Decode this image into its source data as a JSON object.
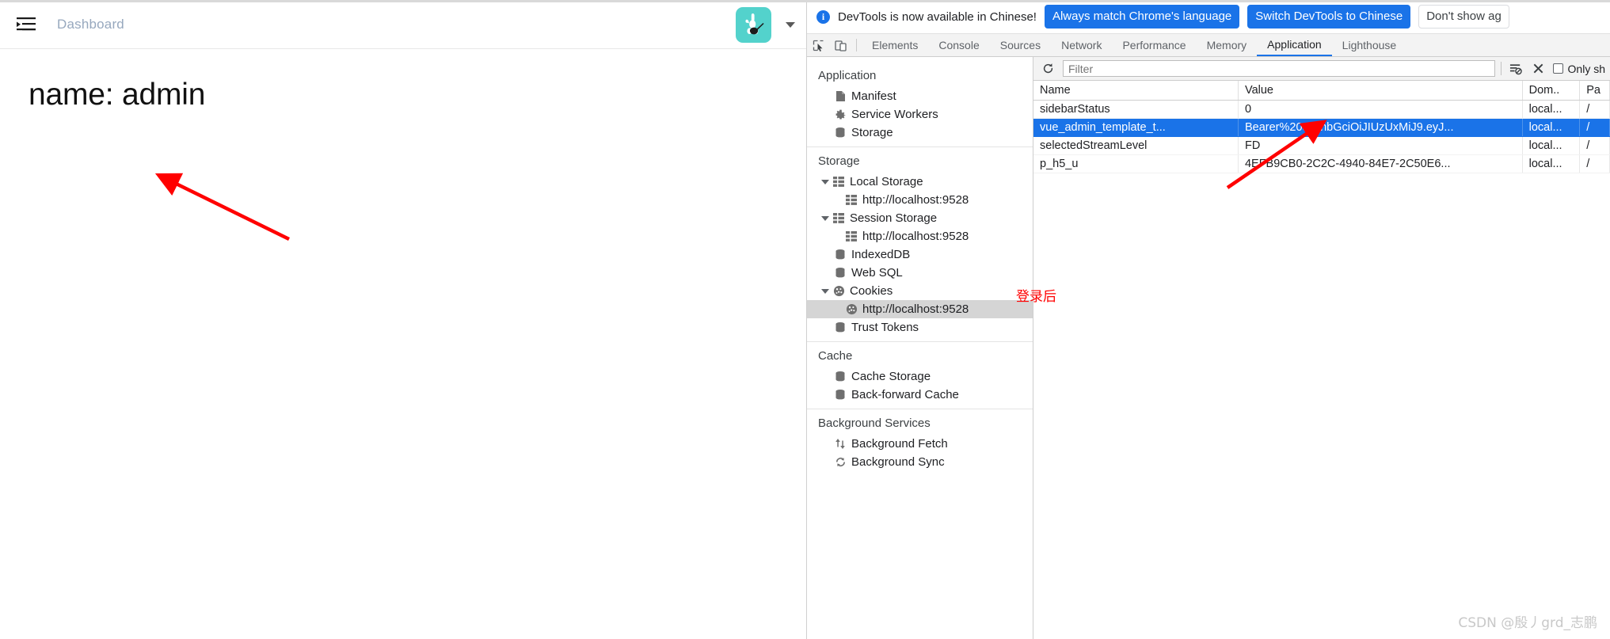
{
  "webpage": {
    "hamburger_icon": "hamburger-menu-icon",
    "breadcrumb": "Dashboard",
    "avatar_icon": "cat-avatar-icon",
    "avatar_color": "#53d2cc",
    "caret_icon": "chevron-down-icon",
    "heading": "name: admin"
  },
  "devtools": {
    "banner": {
      "info_icon": "info-icon",
      "text": "DevTools is now available in Chinese!",
      "buttons": [
        {
          "label": "Always match Chrome's language",
          "style": "primary"
        },
        {
          "label": "Switch DevTools to Chinese",
          "style": "primary"
        },
        {
          "label": "Don't show ag",
          "style": "secondary"
        }
      ],
      "primary_color": "#1a73e8"
    },
    "toolbar_icons": [
      {
        "name": "inspect-element-icon"
      },
      {
        "name": "device-toolbar-icon"
      }
    ],
    "tabs": [
      {
        "label": "Elements",
        "active": false
      },
      {
        "label": "Console",
        "active": false
      },
      {
        "label": "Sources",
        "active": false
      },
      {
        "label": "Network",
        "active": false
      },
      {
        "label": "Performance",
        "active": false
      },
      {
        "label": "Memory",
        "active": false
      },
      {
        "label": "Application",
        "active": true
      },
      {
        "label": "Lighthouse",
        "active": false
      }
    ],
    "sidebar": {
      "sections": [
        {
          "title": "Application",
          "items": [
            {
              "label": "Manifest",
              "icon": "document-icon",
              "indent": 2,
              "twisty": false,
              "selected": false
            },
            {
              "label": "Service Workers",
              "icon": "gear-icon",
              "indent": 2,
              "twisty": false,
              "selected": false
            },
            {
              "label": "Storage",
              "icon": "database-icon",
              "indent": 2,
              "twisty": false,
              "selected": false
            }
          ]
        },
        {
          "title": "Storage",
          "items": [
            {
              "label": "Local Storage",
              "icon": "table-icon",
              "indent": 1,
              "twisty": true,
              "selected": false
            },
            {
              "label": "http://localhost:9528",
              "icon": "table-icon",
              "indent": 3,
              "twisty": false,
              "selected": false
            },
            {
              "label": "Session Storage",
              "icon": "table-icon",
              "indent": 1,
              "twisty": true,
              "selected": false
            },
            {
              "label": "http://localhost:9528",
              "icon": "table-icon",
              "indent": 3,
              "twisty": false,
              "selected": false
            },
            {
              "label": "IndexedDB",
              "icon": "database-icon",
              "indent": 2,
              "twisty": false,
              "selected": false
            },
            {
              "label": "Web SQL",
              "icon": "database-icon",
              "indent": 2,
              "twisty": false,
              "selected": false
            },
            {
              "label": "Cookies",
              "icon": "cookie-icon",
              "indent": 1,
              "twisty": true,
              "selected": false
            },
            {
              "label": "http://localhost:9528",
              "icon": "cookie-icon",
              "indent": 3,
              "twisty": false,
              "selected": true
            },
            {
              "label": "Trust Tokens",
              "icon": "database-icon",
              "indent": 2,
              "twisty": false,
              "selected": false
            }
          ]
        },
        {
          "title": "Cache",
          "items": [
            {
              "label": "Cache Storage",
              "icon": "database-icon",
              "indent": 2,
              "twisty": false,
              "selected": false
            },
            {
              "label": "Back-forward Cache",
              "icon": "database-icon",
              "indent": 2,
              "twisty": false,
              "selected": false
            }
          ]
        },
        {
          "title": "Background Services",
          "items": [
            {
              "label": "Background Fetch",
              "icon": "updown-arrows-icon",
              "indent": 2,
              "twisty": false,
              "selected": false
            },
            {
              "label": "Background Sync",
              "icon": "sync-icon",
              "indent": 2,
              "twisty": false,
              "selected": false
            }
          ]
        }
      ]
    },
    "filterbar": {
      "refresh_icon": "refresh-icon",
      "filter_placeholder": "Filter",
      "filter_value": "",
      "clear_filter_icon": "filter-off-icon",
      "clear_all_icon": "close-x-icon",
      "only_show_label": "Only sh",
      "only_show_checked": false
    },
    "table": {
      "columns": [
        "Name",
        "Value",
        "Dom..",
        "Pa"
      ],
      "rows": [
        {
          "name": "sidebarStatus",
          "value": "0",
          "domain": "local...",
          "path": "/",
          "selected": false
        },
        {
          "name": "vue_admin_template_t...",
          "value": "Bearer%20eyJhbGciOiJIUzUxMiJ9.eyJ...",
          "domain": "local...",
          "path": "/",
          "selected": true
        },
        {
          "name": "selectedStreamLevel",
          "value": "FD",
          "domain": "local...",
          "path": "/",
          "selected": false
        },
        {
          "name": "p_h5_u",
          "value": "4EFB9CB0-2C2C-4940-84E7-2C50E6...",
          "domain": "local...",
          "path": "/",
          "selected": false
        }
      ]
    }
  },
  "annotations": {
    "arrow_left": "red-arrow-icon",
    "arrow_right": "red-arrow-icon",
    "login_note": "登录后",
    "watermark": "CSDN @殷丿grd_志鹏",
    "red": "#ff0000"
  }
}
